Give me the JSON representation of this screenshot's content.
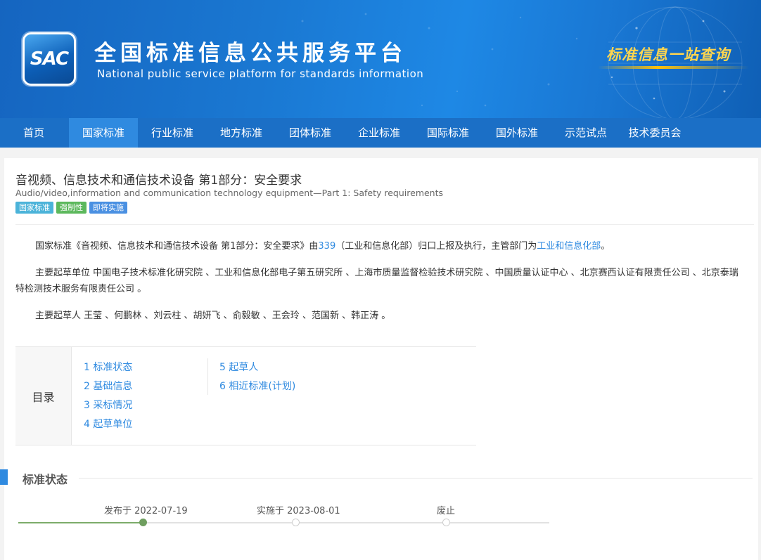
{
  "banner": {
    "logo_text": "SAC",
    "title": "全国标准信息公共服务平台",
    "subtitle": "National public service platform  for standards information",
    "slogan": "标准信息一站查询"
  },
  "nav": {
    "items": [
      {
        "label": "首页"
      },
      {
        "label": "国家标准",
        "active": true
      },
      {
        "label": "行业标准"
      },
      {
        "label": "地方标准"
      },
      {
        "label": "团体标准"
      },
      {
        "label": "企业标准"
      },
      {
        "label": "国际标准"
      },
      {
        "label": "国外标准"
      },
      {
        "label": "示范试点"
      },
      {
        "label": "技术委员会"
      }
    ]
  },
  "standard": {
    "title": "音视频、信息技术和通信技术设备 第1部分：安全要求",
    "title_en": "Audio/video,information and communication technology equipment—Part 1: Safety requirements",
    "tags": [
      "国家标准",
      "强制性",
      "即将实施"
    ]
  },
  "intro": {
    "prefix": "国家标准《音视频、信息技术和通信技术设备 第1部分：安全要求》由",
    "committee_link": "339",
    "middle": "（工业和信息化部）归口上报及执行，主管部门为",
    "dept_link": "工业和信息化部",
    "suffix": "。"
  },
  "drafting_units": {
    "label": "主要起草单位",
    "text": " 中国电子技术标准化研究院 、工业和信息化部电子第五研究所 、上海市质量监督检验技术研究院 、中国质量认证中心 、北京赛西认证有限责任公司 、北京泰瑞特检测技术服务有限责任公司 。"
  },
  "drafters": {
    "label": "主要起草人",
    "text": " 王莹 、何鹏林 、刘云柱 、胡妍飞 、俞毅敏 、王会玲 、范国新 、韩正涛 。"
  },
  "toc": {
    "label": "目录",
    "col1": [
      "1 标准状态",
      "2 基础信息",
      "3 采标情况",
      "4 起草单位"
    ],
    "col2": [
      "5 起草人",
      "6 相近标准(计划)"
    ]
  },
  "status_section": {
    "title": "标准状态",
    "timeline": [
      {
        "label": "发布于 2022-07-19",
        "done": true
      },
      {
        "label": "实施于 2023-08-01",
        "done": false
      },
      {
        "label": "废止",
        "done": false
      }
    ]
  }
}
